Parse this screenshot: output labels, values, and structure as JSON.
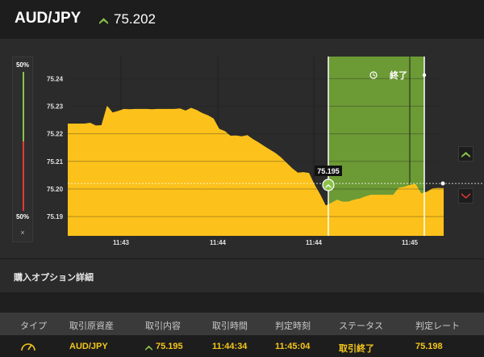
{
  "header": {
    "pair": "AUD/JPY",
    "price": "75.202",
    "direction_icon": "up-arrow-icon"
  },
  "colors": {
    "area_fill": "#fcc21b",
    "window_fill": "#6c9a35",
    "up": "#8bc34a",
    "down": "#e53935",
    "background": "#2b2b2b"
  },
  "meter": {
    "top_label": "50%",
    "bottom_label": "50%",
    "close_label": "×"
  },
  "option_window": {
    "label": "終了",
    "clock_icon": "clock-icon"
  },
  "entry_marker": {
    "label": "75.195",
    "icon": "up-arrow-icon"
  },
  "chart_data": {
    "type": "area",
    "ylim": [
      75.183,
      75.248
    ],
    "y_ticks": [
      "75.24",
      "75.23",
      "75.22",
      "75.21",
      "75.20",
      "75.19"
    ],
    "x_ticks": [
      "11:43",
      "11:44",
      "11:44",
      "11:45"
    ],
    "current_rate": 75.202,
    "entry_rate": 75.195,
    "series": [
      {
        "values": [
          75.2237,
          75.2237,
          75.2237,
          75.2237,
          75.224,
          75.223,
          75.2231,
          75.2302,
          75.2277,
          75.2283,
          75.229,
          75.2289,
          75.229,
          75.229,
          75.229,
          75.2289,
          75.229,
          75.229,
          75.229,
          75.229,
          75.2292,
          75.2284,
          75.2294,
          75.2286,
          75.2275,
          75.2267,
          75.2255,
          75.2218,
          75.221,
          75.2193,
          75.2194,
          75.2191,
          75.2195,
          75.2181,
          75.2169,
          75.2156,
          75.2143,
          75.2131,
          75.2115,
          75.2095,
          75.2075,
          75.2059,
          75.2061,
          75.2058,
          75.2016,
          75.198,
          75.194,
          75.195,
          75.1961,
          75.1954,
          75.1954,
          75.1961,
          75.1965,
          75.1973,
          75.1979,
          75.1979,
          75.1979,
          75.1979,
          75.1979,
          75.2005,
          75.2008,
          75.2015,
          75.2018,
          75.1984,
          75.199,
          75.2002,
          75.2004,
          75.2003
        ]
      }
    ]
  },
  "details": {
    "title": "購入オプション詳細",
    "columns": [
      "タイプ",
      "取引原資産",
      "取引内容",
      "取引時間",
      "判定時刻",
      "ステータス",
      "判定レート"
    ],
    "row": {
      "type_icon": "gauge-icon",
      "asset": "AUD/JPY",
      "direction_icon": "up-arrow-icon",
      "entry": "75.195",
      "trade_time": "11:44:34",
      "judge_time": "11:45:04",
      "status": "取引終了",
      "judge_rate": "75.198"
    }
  }
}
